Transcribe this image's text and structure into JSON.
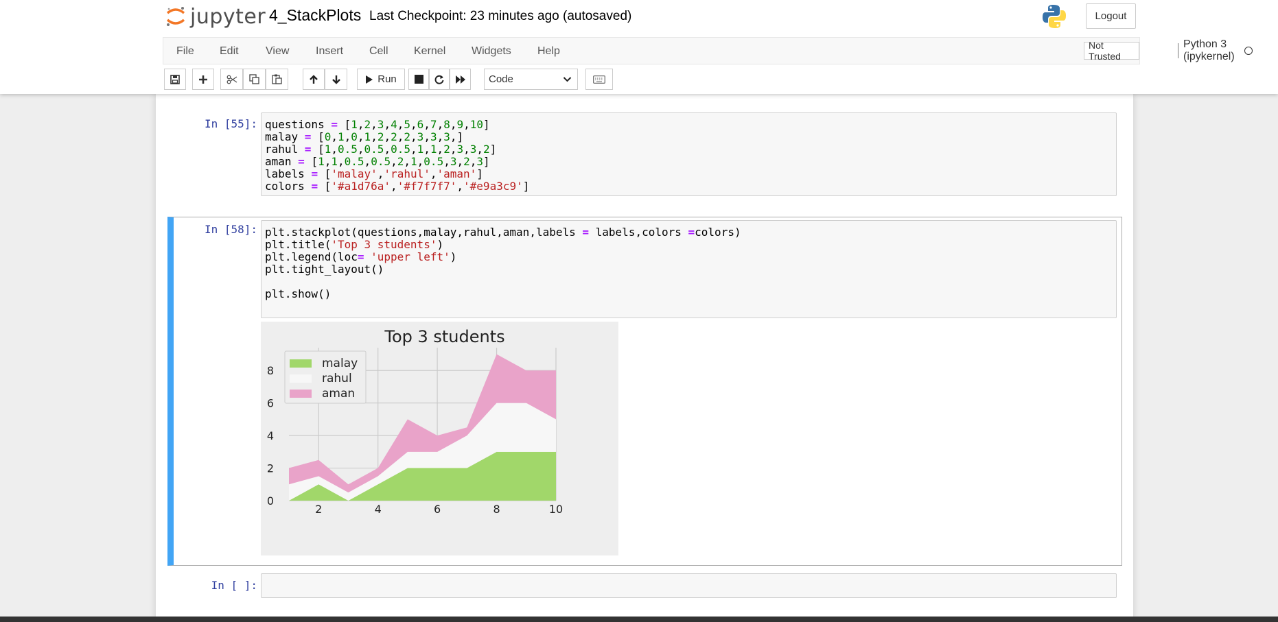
{
  "header": {
    "logo_text": "jupyter",
    "notebook_title": "4_StackPlots",
    "checkpoint": "Last Checkpoint: 23 minutes ago  (autosaved)",
    "logout_label": "Logout"
  },
  "menu": {
    "items": [
      "File",
      "Edit",
      "View",
      "Insert",
      "Cell",
      "Kernel",
      "Widgets",
      "Help"
    ],
    "trust_label": "Not Trusted",
    "kernel_label": "Python 3 (ipykernel)"
  },
  "toolbar": {
    "run_label": "Run",
    "cell_type": "Code",
    "icons": [
      "save-icon",
      "plus-icon",
      "cut-icon",
      "copy-icon",
      "paste-icon",
      "arrow-up-icon",
      "arrow-down-icon",
      "run-icon",
      "stop-icon",
      "restart-icon",
      "fast-forward-icon",
      "chevron-down-icon",
      "keyboard-icon"
    ]
  },
  "cells": [
    {
      "prompt": "In [55]:",
      "lines": [
        [
          [
            "questions ",
            ""
          ],
          [
            "=",
            "kw"
          ],
          [
            " [",
            ""
          ],
          [
            "1",
            "nm"
          ],
          [
            ",",
            ""
          ],
          [
            "2",
            "nm"
          ],
          [
            ",",
            ""
          ],
          [
            "3",
            "nm"
          ],
          [
            ",",
            ""
          ],
          [
            "4",
            "nm"
          ],
          [
            ",",
            ""
          ],
          [
            "5",
            "nm"
          ],
          [
            ",",
            ""
          ],
          [
            "6",
            "nm"
          ],
          [
            ",",
            ""
          ],
          [
            "7",
            "nm"
          ],
          [
            ",",
            ""
          ],
          [
            "8",
            "nm"
          ],
          [
            ",",
            ""
          ],
          [
            "9",
            "nm"
          ],
          [
            ",",
            ""
          ],
          [
            "10",
            "nm"
          ],
          [
            "]",
            ""
          ]
        ],
        [
          [
            "malay ",
            ""
          ],
          [
            "=",
            "kw"
          ],
          [
            " [",
            ""
          ],
          [
            "0",
            "nm"
          ],
          [
            ",",
            ""
          ],
          [
            "1",
            "nm"
          ],
          [
            ",",
            ""
          ],
          [
            "0",
            "nm"
          ],
          [
            ",",
            ""
          ],
          [
            "1",
            "nm"
          ],
          [
            ",",
            ""
          ],
          [
            "2",
            "nm"
          ],
          [
            ",",
            ""
          ],
          [
            "2",
            "nm"
          ],
          [
            ",",
            ""
          ],
          [
            "2",
            "nm"
          ],
          [
            ",",
            ""
          ],
          [
            "3",
            "nm"
          ],
          [
            ",",
            ""
          ],
          [
            "3",
            "nm"
          ],
          [
            ",",
            ""
          ],
          [
            "3",
            "nm"
          ],
          [
            ",]",
            ""
          ]
        ],
        [
          [
            "rahul ",
            ""
          ],
          [
            "=",
            "kw"
          ],
          [
            " [",
            ""
          ],
          [
            "1",
            "nm"
          ],
          [
            ",",
            ""
          ],
          [
            "0.5",
            "nm"
          ],
          [
            ",",
            ""
          ],
          [
            "0.5",
            "nm"
          ],
          [
            ",",
            ""
          ],
          [
            "0.5",
            "nm"
          ],
          [
            ",",
            ""
          ],
          [
            "1",
            "nm"
          ],
          [
            ",",
            ""
          ],
          [
            "1",
            "nm"
          ],
          [
            ",",
            ""
          ],
          [
            "2",
            "nm"
          ],
          [
            ",",
            ""
          ],
          [
            "3",
            "nm"
          ],
          [
            ",",
            ""
          ],
          [
            "3",
            "nm"
          ],
          [
            ",",
            ""
          ],
          [
            "2",
            "nm"
          ],
          [
            "]",
            ""
          ]
        ],
        [
          [
            "aman ",
            ""
          ],
          [
            "=",
            "kw"
          ],
          [
            " [",
            ""
          ],
          [
            "1",
            "nm"
          ],
          [
            ",",
            ""
          ],
          [
            "1",
            "nm"
          ],
          [
            ",",
            ""
          ],
          [
            "0.5",
            "nm"
          ],
          [
            ",",
            ""
          ],
          [
            "0.5",
            "nm"
          ],
          [
            ",",
            ""
          ],
          [
            "2",
            "nm"
          ],
          [
            ",",
            ""
          ],
          [
            "1",
            "nm"
          ],
          [
            ",",
            ""
          ],
          [
            "0.5",
            "nm"
          ],
          [
            ",",
            ""
          ],
          [
            "3",
            "nm"
          ],
          [
            ",",
            ""
          ],
          [
            "2",
            "nm"
          ],
          [
            ",",
            ""
          ],
          [
            "3",
            "nm"
          ],
          [
            "]",
            ""
          ]
        ],
        [
          [
            "labels ",
            ""
          ],
          [
            "=",
            "kw"
          ],
          [
            " [",
            ""
          ],
          [
            "'malay'",
            "st"
          ],
          [
            ",",
            ""
          ],
          [
            "'rahul'",
            "st"
          ],
          [
            ",",
            ""
          ],
          [
            "'aman'",
            "st"
          ],
          [
            "]",
            ""
          ]
        ],
        [
          [
            "colors ",
            ""
          ],
          [
            "=",
            "kw"
          ],
          [
            " [",
            ""
          ],
          [
            "'#a1d76a'",
            "st"
          ],
          [
            ",",
            ""
          ],
          [
            "'#f7f7f7'",
            "st"
          ],
          [
            ",",
            ""
          ],
          [
            "'#e9a3c9'",
            "st"
          ],
          [
            "]",
            ""
          ]
        ]
      ]
    },
    {
      "prompt": "In [58]:",
      "lines": [
        [
          [
            "plt.stackplot(questions,malay,rahul,aman,labels ",
            ""
          ],
          [
            "=",
            "kw"
          ],
          [
            " labels,colors ",
            ""
          ],
          [
            "=",
            "kw"
          ],
          [
            "colors)",
            ""
          ]
        ],
        [
          [
            "plt.title(",
            ""
          ],
          [
            "'Top 3 students'",
            "st"
          ],
          [
            ")",
            ""
          ]
        ],
        [
          [
            "plt.legend(loc",
            ""
          ],
          [
            "=",
            "kw"
          ],
          [
            " ",
            ""
          ],
          [
            "'upper left'",
            "st"
          ],
          [
            ")",
            ""
          ]
        ],
        [
          [
            "plt.tight_layout()",
            ""
          ]
        ],
        [
          [
            "",
            ""
          ]
        ],
        [
          [
            "plt.show()",
            ""
          ]
        ]
      ]
    },
    {
      "prompt": "In [ ]:",
      "lines": []
    }
  ],
  "chart_data": {
    "type": "area",
    "title": "Top 3 students",
    "x": [
      1,
      2,
      3,
      4,
      5,
      6,
      7,
      8,
      9,
      10
    ],
    "series": [
      {
        "name": "malay",
        "color": "#a1d76a",
        "values": [
          0,
          1,
          0,
          1,
          2,
          2,
          2,
          3,
          3,
          3
        ]
      },
      {
        "name": "rahul",
        "color": "#f7f7f7",
        "values": [
          1,
          0.5,
          0.5,
          0.5,
          1,
          1,
          2,
          3,
          3,
          2
        ]
      },
      {
        "name": "aman",
        "color": "#e9a3c9",
        "values": [
          1,
          1,
          0.5,
          0.5,
          2,
          1,
          0.5,
          3,
          2,
          3
        ]
      }
    ],
    "xticks": [
      "2",
      "4",
      "6",
      "8",
      "10"
    ],
    "yticks": [
      "0",
      "2",
      "4",
      "6",
      "8"
    ],
    "xlim": [
      1,
      10
    ],
    "ylim": [
      0,
      9.4
    ],
    "grid": true,
    "legend_position": "upper left"
  }
}
